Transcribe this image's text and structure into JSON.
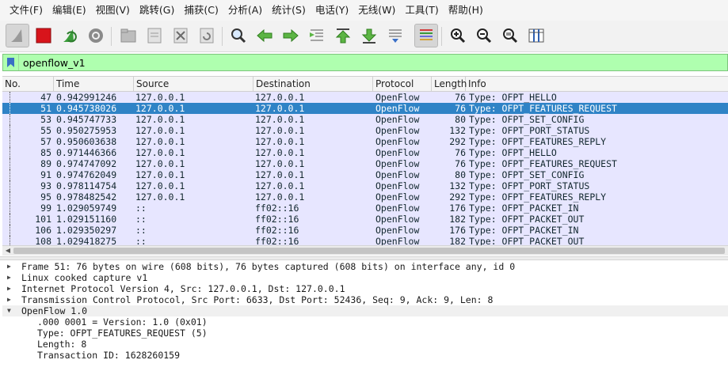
{
  "menu": [
    "文件(F)",
    "编辑(E)",
    "视图(V)",
    "跳转(G)",
    "捕获(C)",
    "分析(A)",
    "统计(S)",
    "电话(Y)",
    "无线(W)",
    "工具(T)",
    "帮助(H)"
  ],
  "toolbar": {
    "icons": [
      "shark-fin-start-icon",
      "stop-capture-icon",
      "restart-capture-icon",
      "capture-options-icon",
      "open-file-icon",
      "save-file-icon",
      "close-file-icon",
      "reload-file-icon",
      "find-packet-icon",
      "go-back-icon",
      "go-forward-icon",
      "go-to-packet-icon",
      "first-packet-icon",
      "last-packet-icon",
      "autoscroll-icon",
      "colorize-icon",
      "zoom-in-icon",
      "zoom-out-icon",
      "normal-size-icon",
      "resize-columns-icon"
    ]
  },
  "filter": {
    "value": "openflow_v1"
  },
  "columns": [
    "No.",
    "Time",
    "Source",
    "Destination",
    "Protocol",
    "Length",
    "Info"
  ],
  "packets": [
    {
      "no": "47",
      "time": "0.942991246",
      "src": "127.0.0.1",
      "dst": "127.0.0.1",
      "proto": "OpenFlow",
      "len": "76",
      "info": "Type: OFPT_HELLO"
    },
    {
      "no": "51",
      "time": "0.945738026",
      "src": "127.0.0.1",
      "dst": "127.0.0.1",
      "proto": "OpenFlow",
      "len": "76",
      "info": "Type: OFPT_FEATURES_REQUEST",
      "selected": true
    },
    {
      "no": "53",
      "time": "0.945747733",
      "src": "127.0.0.1",
      "dst": "127.0.0.1",
      "proto": "OpenFlow",
      "len": "80",
      "info": "Type: OFPT_SET_CONFIG"
    },
    {
      "no": "55",
      "time": "0.950275953",
      "src": "127.0.0.1",
      "dst": "127.0.0.1",
      "proto": "OpenFlow",
      "len": "132",
      "info": "Type: OFPT_PORT_STATUS"
    },
    {
      "no": "57",
      "time": "0.950603638",
      "src": "127.0.0.1",
      "dst": "127.0.0.1",
      "proto": "OpenFlow",
      "len": "292",
      "info": "Type: OFPT_FEATURES_REPLY"
    },
    {
      "no": "85",
      "time": "0.971446366",
      "src": "127.0.0.1",
      "dst": "127.0.0.1",
      "proto": "OpenFlow",
      "len": "76",
      "info": "Type: OFPT_HELLO"
    },
    {
      "no": "89",
      "time": "0.974747092",
      "src": "127.0.0.1",
      "dst": "127.0.0.1",
      "proto": "OpenFlow",
      "len": "76",
      "info": "Type: OFPT_FEATURES_REQUEST"
    },
    {
      "no": "91",
      "time": "0.974762049",
      "src": "127.0.0.1",
      "dst": "127.0.0.1",
      "proto": "OpenFlow",
      "len": "80",
      "info": "Type: OFPT_SET_CONFIG"
    },
    {
      "no": "93",
      "time": "0.978114754",
      "src": "127.0.0.1",
      "dst": "127.0.0.1",
      "proto": "OpenFlow",
      "len": "132",
      "info": "Type: OFPT_PORT_STATUS"
    },
    {
      "no": "95",
      "time": "0.978482542",
      "src": "127.0.0.1",
      "dst": "127.0.0.1",
      "proto": "OpenFlow",
      "len": "292",
      "info": "Type: OFPT_FEATURES_REPLY"
    },
    {
      "no": "99",
      "time": "1.029059749",
      "src": "::",
      "dst": "ff02::16",
      "proto": "OpenFlow",
      "len": "176",
      "info": "Type: OFPT_PACKET_IN"
    },
    {
      "no": "101",
      "time": "1.029151160",
      "src": "::",
      "dst": "ff02::16",
      "proto": "OpenFlow",
      "len": "182",
      "info": "Type: OFPT_PACKET_OUT"
    },
    {
      "no": "106",
      "time": "1.029350297",
      "src": "::",
      "dst": "ff02::16",
      "proto": "OpenFlow",
      "len": "176",
      "info": "Type: OFPT_PACKET_IN"
    },
    {
      "no": "108",
      "time": "1.029418275",
      "src": "::",
      "dst": "ff02::16",
      "proto": "OpenFlow",
      "len": "182",
      "info": "Type: OFPT_PACKET_OUT"
    }
  ],
  "details": [
    {
      "text": "Frame 51: 76 bytes on wire (608 bits), 76 bytes captured (608 bits) on interface any, id 0",
      "expanded": false
    },
    {
      "text": "Linux cooked capture v1",
      "expanded": false
    },
    {
      "text": "Internet Protocol Version 4, Src: 127.0.0.1, Dst: 127.0.0.1",
      "expanded": false
    },
    {
      "text": "Transmission Control Protocol, Src Port: 6633, Dst Port: 52436, Seq: 9, Ack: 9, Len: 8",
      "expanded": false
    },
    {
      "text": "OpenFlow 1.0",
      "expanded": true,
      "children": [
        ".000 0001 = Version: 1.0 (0x01)",
        "Type: OFPT_FEATURES_REQUEST (5)",
        "Length: 8",
        "Transaction ID: 1628260159"
      ]
    }
  ],
  "colors": {
    "row_background": "#e7e6ff",
    "row_selected": "#2f83c6",
    "filter_valid": "#afffaf"
  }
}
